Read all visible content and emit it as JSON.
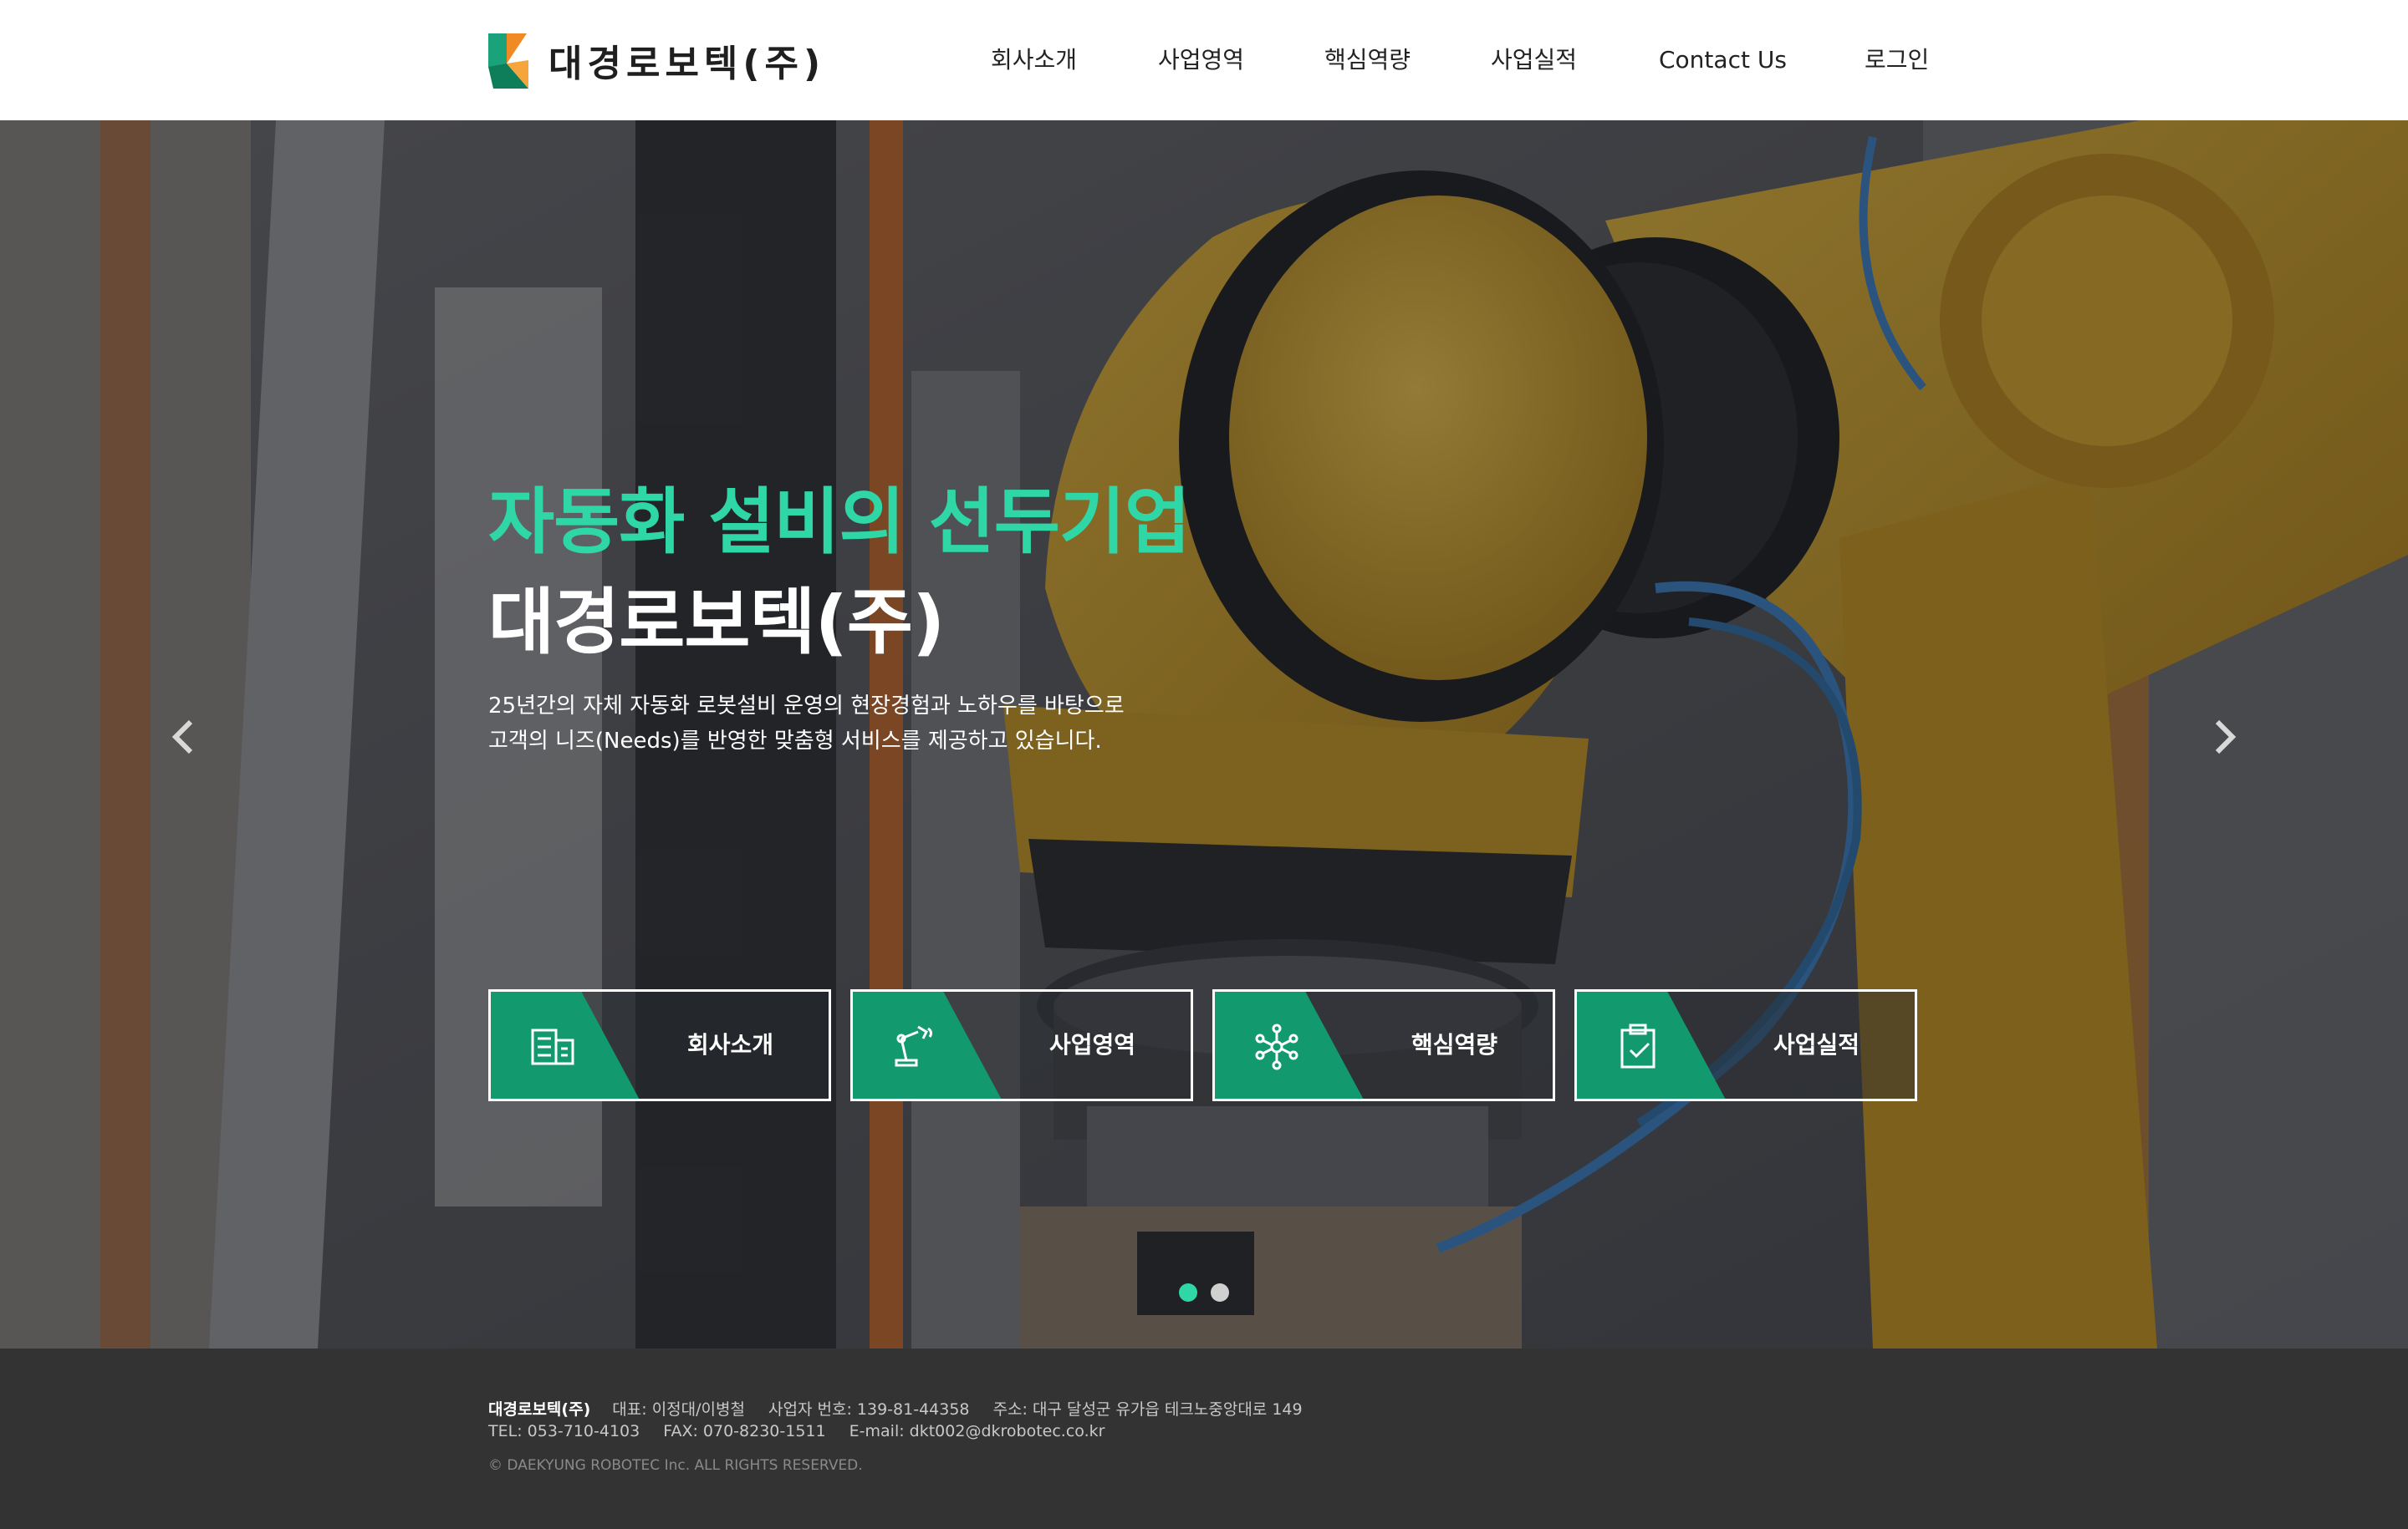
{
  "header": {
    "logo_text": "대경로보텍(주)",
    "nav": [
      "회사소개",
      "사업영역",
      "핵심역량",
      "사업실적",
      "Contact Us",
      "로그인"
    ]
  },
  "hero": {
    "title_green": "자동화 설비의 선두기업",
    "title_white": "대경로보텍(주)",
    "desc_line1": "25년간의 자체 자동화 로봇설비 운영의 현장경험과 노하우를 바탕으로",
    "desc_line2": "고객의 니즈(Needs)를 반영한 맞춤형 서비스를 제공하고 있습니다.",
    "prev_icon": "chevron-left-icon",
    "next_icon": "chevron-right-icon"
  },
  "cards": [
    {
      "label": "회사소개",
      "icon": "building-icon"
    },
    {
      "label": "사업영역",
      "icon": "robot-arm-icon"
    },
    {
      "label": "핵심역량",
      "icon": "network-icon"
    },
    {
      "label": "사업실적",
      "icon": "clipboard-check-icon"
    }
  ],
  "slider": {
    "total": 2,
    "active": 1
  },
  "footer": {
    "company": "대경로보텍(주)",
    "ceo": "대표: 이정대/이병철",
    "biz_no": "사업자 번호: 139-81-44358",
    "address": "주소: 대구 달성군 유가읍 테크노중앙대로 149",
    "tel": "TEL: 053-710-4103",
    "fax": "FAX: 070-8230-1511",
    "email": "E-mail: dkt002@dkrobotec.co.kr",
    "copyright": "© DAEKYUNG ROBOTEC Inc. ALL RIGHTS RESERVED."
  },
  "colors": {
    "accent_green": "#2fd6a6",
    "card_green": "#129a6e",
    "logo_green": "#1aa37a",
    "logo_orange": "#f08a24",
    "footer_bg": "#333333"
  }
}
